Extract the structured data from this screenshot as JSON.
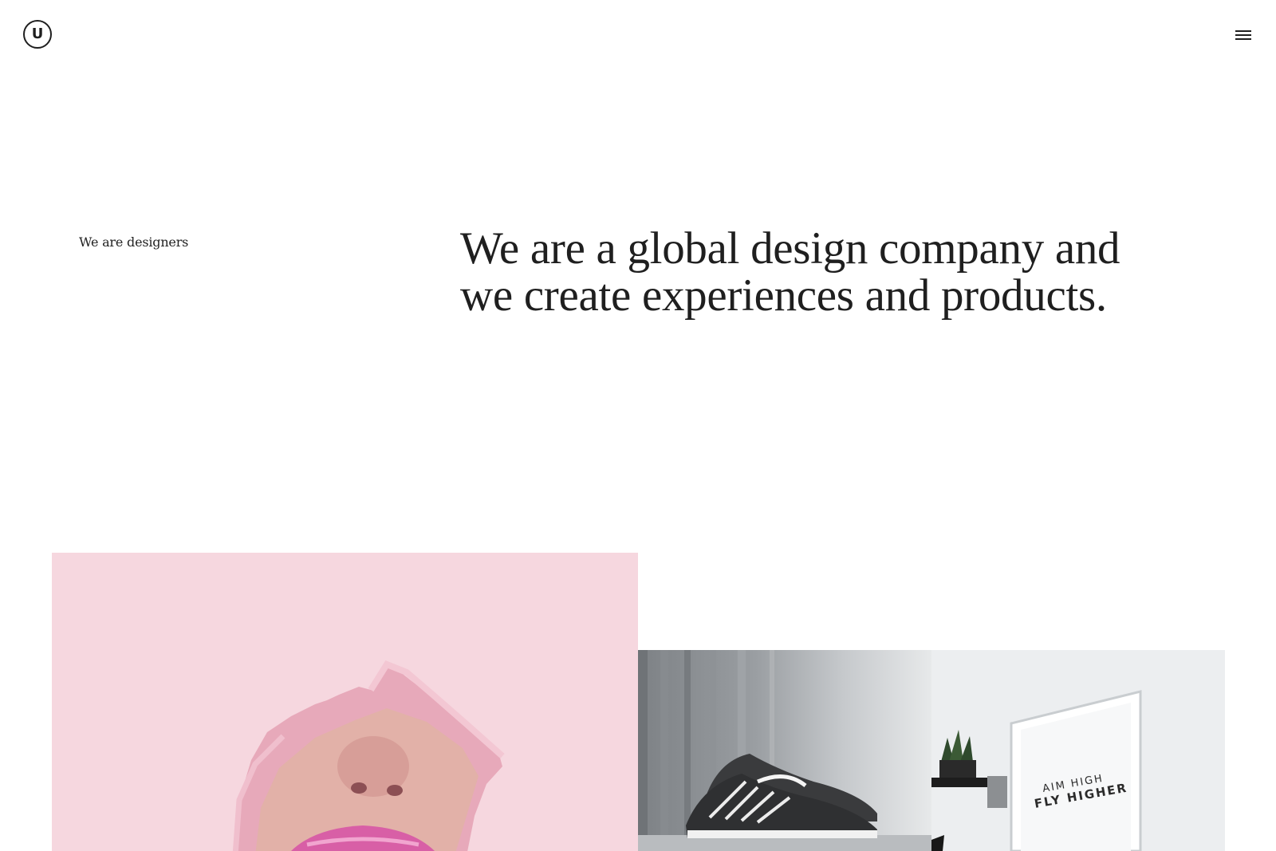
{
  "header": {
    "logo_letter": "U",
    "menu_icon": "hamburger-menu-icon"
  },
  "intro": {
    "eyebrow": "We are designers",
    "headline": "We are a global design company and we create experiences and products."
  },
  "gallery": {
    "tiles": [
      {
        "subject": "pink-lips-paper-tear-photo",
        "accent": "#f6d7df"
      },
      {
        "subject": "sneakers-on-shelf-photo",
        "accent": "#8f9397"
      },
      {
        "subject": "framed-poster-photo",
        "poster_line1": "AIM HIGH",
        "poster_line2": "FLY HIGHER"
      }
    ]
  },
  "colors": {
    "text": "#1f1f1f",
    "background": "#ffffff",
    "pink": "#f6d7df"
  }
}
